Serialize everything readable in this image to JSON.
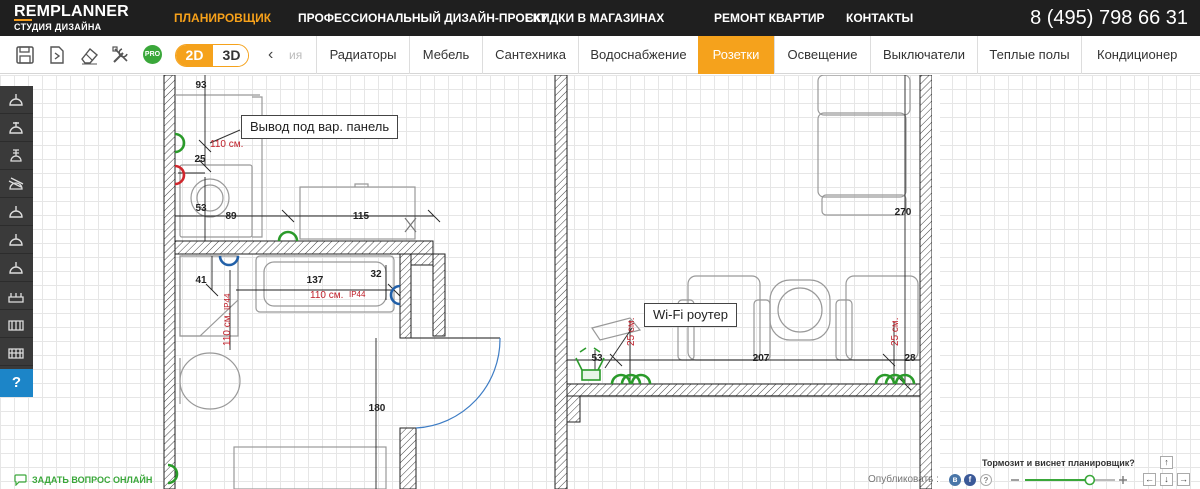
{
  "header": {
    "logo_rem": "REM",
    "logo_planner": "PLANNER",
    "logo_sub": "СТУДИЯ ДИЗАЙНА",
    "nav": [
      {
        "label": "ПЛАНИРОВЩИК",
        "active": true
      },
      {
        "label": "ПРОФЕССИОНАЛЬНЫЙ ДИЗАЙН-ПРОЕКТ",
        "active": false
      },
      {
        "label": "СКИДКИ В МАГАЗИНАХ",
        "active": false
      },
      {
        "label": "РЕМОНТ КВАРТИР",
        "active": false
      },
      {
        "label": "КОНТАКТЫ",
        "active": false
      }
    ],
    "phone_prefix": "8 (495)",
    "phone_number": "798 66 31"
  },
  "toolbar": {
    "icons": [
      "save-icon",
      "export-icon",
      "eraser-icon",
      "tools-icon"
    ],
    "pro_label": "PRO",
    "view_2d": "2D",
    "view_3d": "3D",
    "active_view": "2D",
    "prev_arrow": "‹",
    "cut_tab": "ия",
    "tabs": [
      {
        "label": "Радиаторы",
        "active": false
      },
      {
        "label": "Мебель",
        "active": false
      },
      {
        "label": "Сантехника",
        "active": false
      },
      {
        "label": "Водоснабжение",
        "active": false
      },
      {
        "label": "Розетки",
        "active": true
      },
      {
        "label": "Освещение",
        "active": false
      },
      {
        "label": "Выключатели",
        "active": false
      },
      {
        "label": "Теплые полы",
        "active": false
      },
      {
        "label": "Кондиционер",
        "active": false
      }
    ]
  },
  "sidebar": {
    "tools": [
      "socket-icon",
      "socket-ground-icon",
      "socket-double-icon",
      "socket-cable-icon",
      "socket-icon",
      "socket-icon",
      "socket-icon",
      "socket-block-icon",
      "socket-block-icon",
      "socket-block-icon"
    ],
    "help_label": "?"
  },
  "plan": {
    "callouts": {
      "panel": "Вывод под вар. панель",
      "wifi": "Wi-Fi роутер"
    },
    "dimensions": {
      "d93": "93",
      "d25": "25",
      "d53a": "53",
      "d89": "89",
      "d115": "115",
      "d270": "270",
      "d41": "41",
      "d137": "137",
      "d32": "32",
      "d180": "180",
      "d53b": "53",
      "d207": "207",
      "d28": "28"
    },
    "heights": {
      "h110a": "110 см.",
      "h110b": "110 см.",
      "h110c": "110 см.",
      "ip44a": "IP44",
      "ip44b": "IP44",
      "h25a": "25 см.",
      "h25b": "25 см."
    }
  },
  "footer": {
    "ask_label": "ЗАДАТЬ ВОПРОС ОНЛАЙН",
    "publish_label": "Опубликовать :",
    "social": [
      "vk-icon",
      "facebook-icon",
      "help-circle-icon"
    ],
    "lag_question": "Тормозит и виснет планировщик?",
    "zoom_level": 0.72
  },
  "colors": {
    "accent": "#f5a21c",
    "socket_green": "#2a9a2a",
    "socket_red": "#d0262c",
    "socket_blue": "#2260a8",
    "dim_red": "#c0202a"
  }
}
